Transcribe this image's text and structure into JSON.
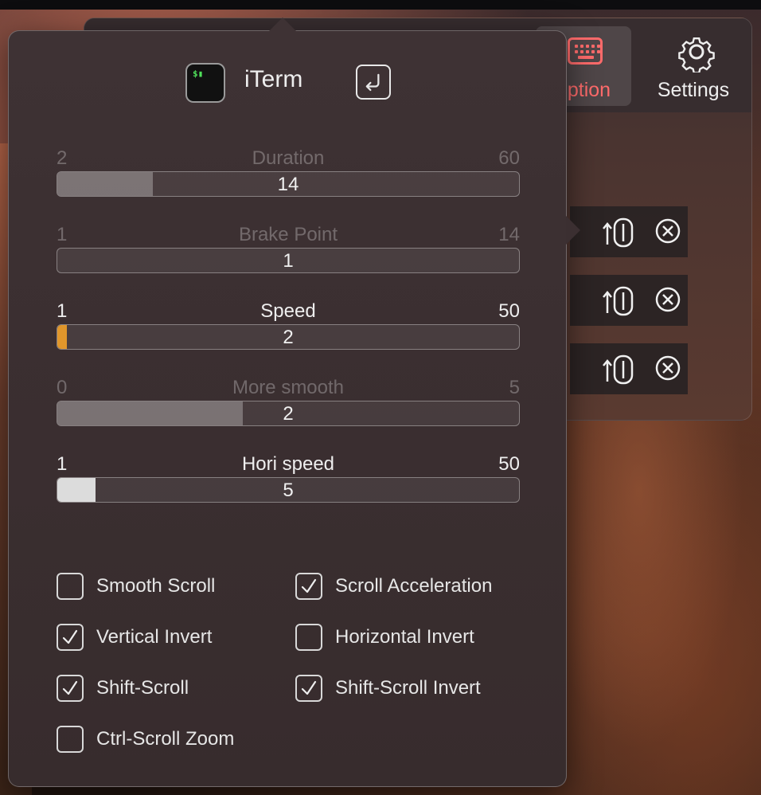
{
  "toolbar": {
    "exception_label": "Exception",
    "exception_visible": "eption",
    "settings_label": "Settings",
    "accent": "#ff6b6b"
  },
  "exception_rows": [
    {
      "wheel_icon": "scroll-wheel-icon",
      "delete_icon": "close-circle-icon"
    },
    {
      "wheel_icon": "scroll-wheel-icon",
      "delete_icon": "close-circle-icon"
    },
    {
      "wheel_icon": "scroll-wheel-icon",
      "delete_icon": "close-circle-icon"
    }
  ],
  "popover": {
    "app_name": "iTerm",
    "app_icon_prompt": "$▮",
    "sliders": [
      {
        "title": "Duration",
        "min": "2",
        "max": "60",
        "value": "14",
        "fraction": 0.207,
        "enabled": false,
        "fill": "rgba(255,255,255,0.28)"
      },
      {
        "title": "Brake Point",
        "min": "1",
        "max": "14",
        "value": "1",
        "fraction": 0.0,
        "enabled": false,
        "fill": "rgba(255,255,255,0.28)"
      },
      {
        "title": "Speed",
        "min": "1",
        "max": "50",
        "value": "2",
        "fraction": 0.02,
        "enabled": true,
        "fill": "#e0962b"
      },
      {
        "title": "More smooth",
        "min": "0",
        "max": "5",
        "value": "2",
        "fraction": 0.4,
        "enabled": false,
        "fill": "rgba(255,255,255,0.28)"
      },
      {
        "title": "Hori speed",
        "min": "1",
        "max": "50",
        "value": "5",
        "fraction": 0.082,
        "enabled": true,
        "fill": "#dcdcdc"
      }
    ],
    "checkboxes": [
      {
        "label": "Smooth Scroll",
        "checked": false
      },
      {
        "label": "Scroll Acceleration",
        "checked": true
      },
      {
        "label": "Vertical Invert",
        "checked": true
      },
      {
        "label": "Horizontal Invert",
        "checked": false
      },
      {
        "label": "Shift-Scroll",
        "checked": true
      },
      {
        "label": "Shift-Scroll Invert",
        "checked": true
      },
      {
        "label": "Ctrl-Scroll Zoom",
        "checked": false
      }
    ]
  }
}
